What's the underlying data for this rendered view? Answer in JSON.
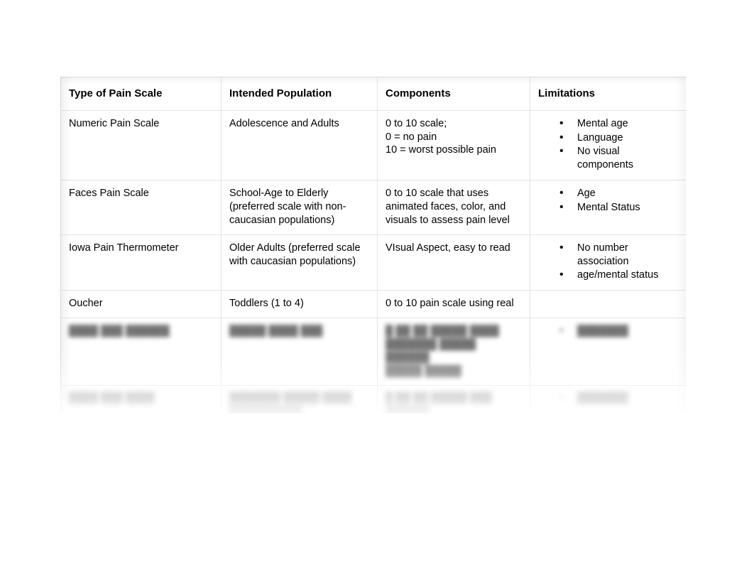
{
  "document": {
    "title": "Pain Scale Comparison Table",
    "background_color": "#ffffff",
    "border_color": "#e3e3e3"
  },
  "table": {
    "headers": [
      "Type of Pain Scale",
      "Intended Population",
      "Components",
      "Limitations"
    ],
    "rows": [
      {
        "legible": true,
        "scale": "Numeric Pain Scale",
        "population": [
          "Adolescence and Adults"
        ],
        "components": [
          "0 to 10 scale;",
          "0 = no pain",
          "10 = worst possible pain"
        ],
        "limitations": [
          "Mental age",
          "Language",
          "No visual components"
        ]
      },
      {
        "legible": true,
        "scale": "Faces Pain Scale",
        "population": [
          "School-Age to Elderly",
          "(preferred scale with non-",
          "caucasian populations)"
        ],
        "components": [
          "0 to 10 scale that uses",
          "animated faces, color, and",
          "visuals to assess pain level"
        ],
        "limitations": [
          "Age",
          "Mental Status"
        ]
      },
      {
        "legible": true,
        "scale": "Iowa Pain Thermometer",
        "population": [
          "Older Adults (preferred scale",
          "with caucasian populations)"
        ],
        "components": [
          "VIsual Aspect, easy to read"
        ],
        "limitations": [
          "No number association",
          "age/mental status"
        ]
      },
      {
        "legible": true,
        "scale": "Oucher",
        "population": [
          "Toddlers (1 to 4)"
        ],
        "components": [
          "0 to 10 pain scale using real"
        ],
        "limitations": []
      },
      {
        "legible": false,
        "scale": "████ ███ ██████",
        "population": [
          "█████ ████ ███"
        ],
        "components": [
          "█ ██ ██ █████ ████",
          "███████ █████ ██████",
          "█████ █████"
        ],
        "limitations": [
          "███████"
        ]
      },
      {
        "legible": false,
        "scale": "████ ███ ████",
        "population": [
          "███████ █████ ████",
          "██████████"
        ],
        "components": [
          "█ ██ ██ █████ ███",
          "██████"
        ],
        "limitations": [
          "███████"
        ]
      },
      {
        "legible": false,
        "scale": "██████████ ██████████ ███████",
        "population": [
          "██████ ████████"
        ],
        "components": [
          "████████ █████████ ███",
          "██████ ████████ ████",
          "███████"
        ],
        "limitations": [
          "███████████",
          "█████",
          "██████"
        ]
      }
    ]
  }
}
